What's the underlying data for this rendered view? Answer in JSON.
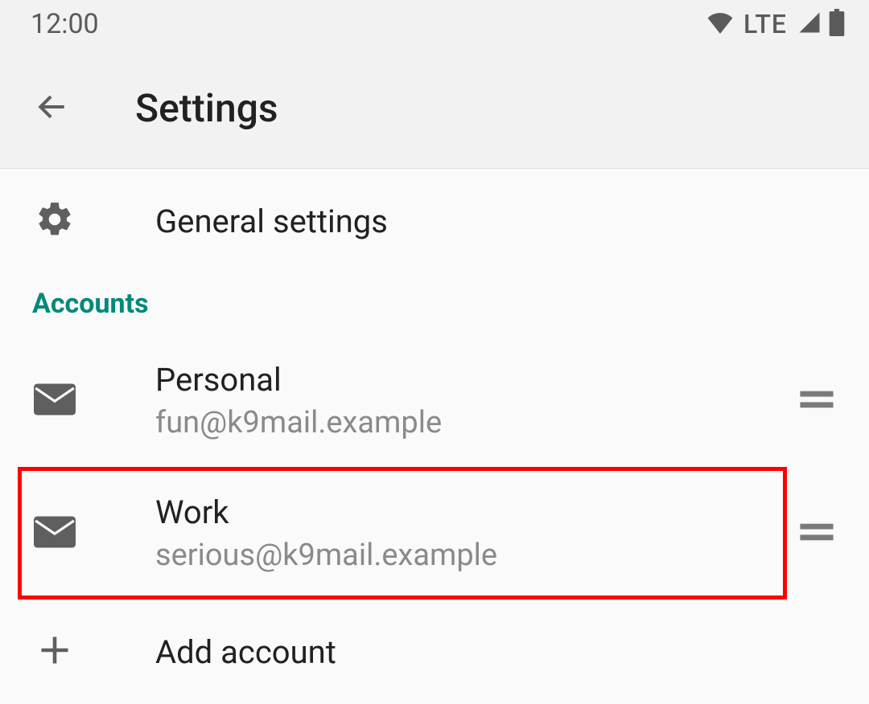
{
  "status": {
    "time": "12:00",
    "network": "LTE"
  },
  "header": {
    "title": "Settings"
  },
  "general": {
    "label": "General settings"
  },
  "sections": {
    "accounts_header": "Accounts"
  },
  "accounts": [
    {
      "name": "Personal",
      "email": "fun@k9mail.example",
      "highlighted": false
    },
    {
      "name": "Work",
      "email": "serious@k9mail.example",
      "highlighted": true
    }
  ],
  "add_account": {
    "label": "Add account"
  },
  "colors": {
    "accent": "#00897b",
    "icon": "#5f5f5f"
  }
}
